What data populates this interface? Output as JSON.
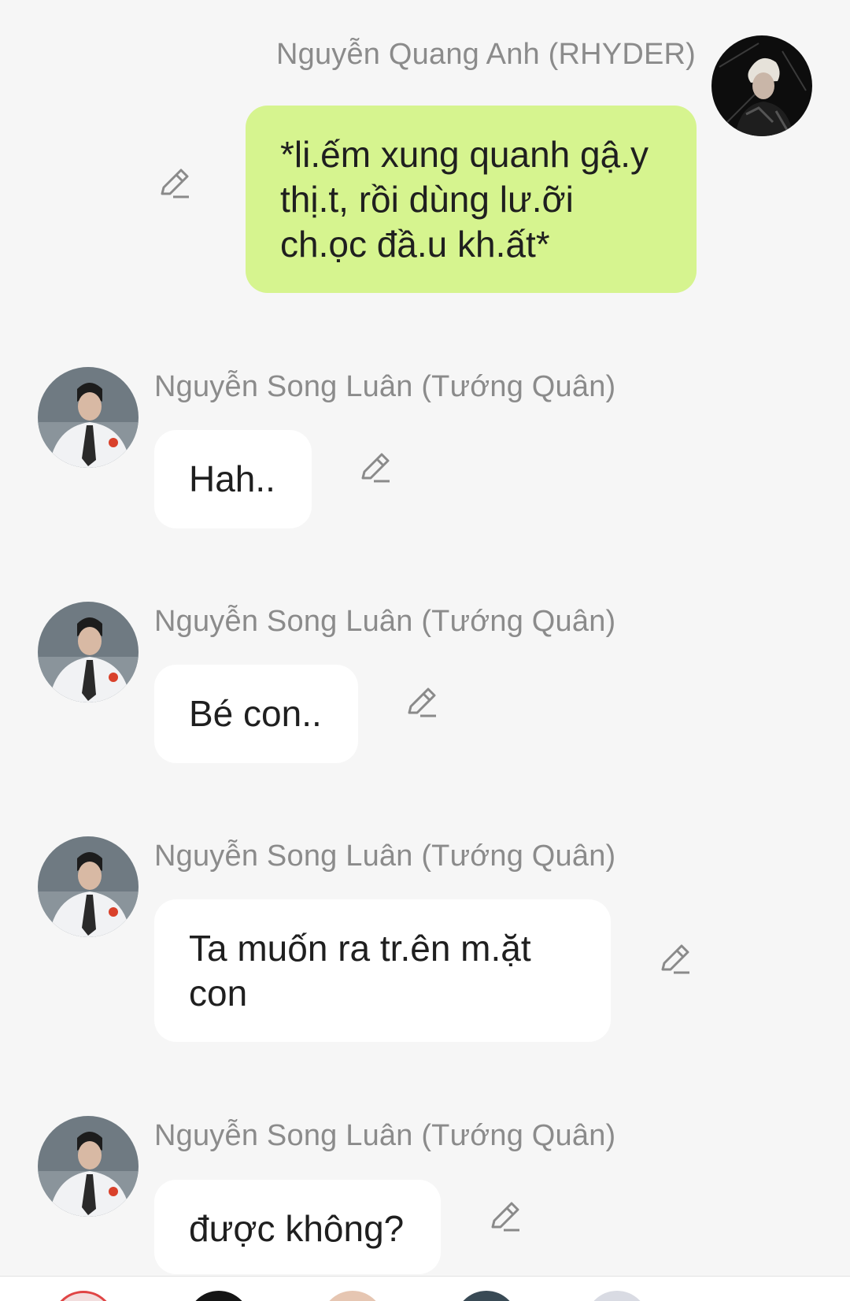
{
  "messages": [
    {
      "sender": "Nguyễn Quang Anh (RHYDER)",
      "text": "*li.ếm xung quanh gậ.y thị.t, rồi dùng lư.ỡi ch.ọc đầ.u kh.ất*",
      "side": "self"
    },
    {
      "sender": "Nguyễn Song Luân (Tướng Quân)",
      "text": "Hah..",
      "side": "other"
    },
    {
      "sender": "Nguyễn Song Luân (Tướng Quân)",
      "text": "Bé con..",
      "side": "other"
    },
    {
      "sender": "Nguyễn Song Luân (Tướng Quân)",
      "text": "Ta muốn ra tr.ên m.ặt con",
      "side": "other"
    },
    {
      "sender": "Nguyễn Song Luân (Tướng Quân)",
      "text": "được không?",
      "side": "other"
    }
  ],
  "icons": {
    "edit": "pencil-icon",
    "avatar_self": "avatar-rhyder",
    "avatar_other": "avatar-tuong-quan"
  },
  "colors": {
    "background": "#f6f6f6",
    "self_bubble": "#d6f48f",
    "other_bubble": "#ffffff",
    "sender_name": "#8b8b8b",
    "message_text": "#1f1f1f"
  }
}
